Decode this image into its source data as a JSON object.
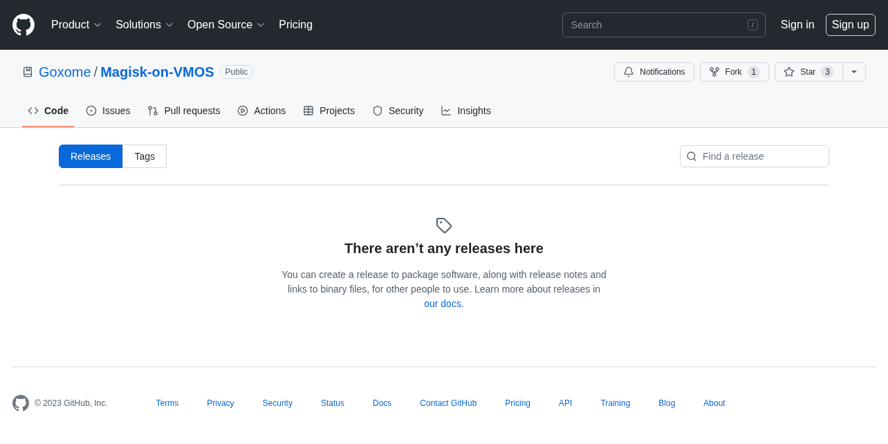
{
  "header": {
    "nav": [
      {
        "label": "Product",
        "dropdown": true
      },
      {
        "label": "Solutions",
        "dropdown": true
      },
      {
        "label": "Open Source",
        "dropdown": true
      },
      {
        "label": "Pricing",
        "dropdown": false
      }
    ],
    "search": {
      "placeholder": "Search",
      "shortcut": "/"
    },
    "sign_in": "Sign in",
    "sign_up": "Sign up"
  },
  "repo": {
    "owner": "Goxome",
    "separator": "/",
    "name": "Magisk-on-VMOS",
    "visibility": "Public",
    "actions": [
      {
        "label": "Notifications"
      },
      {
        "label": "Fork",
        "count": "1"
      },
      {
        "label": "Star",
        "count": "3"
      }
    ]
  },
  "tabs": [
    {
      "label": "Code",
      "selected": true
    },
    {
      "label": "Issues",
      "selected": false
    },
    {
      "label": "Pull requests",
      "selected": false
    },
    {
      "label": "Actions",
      "selected": false
    },
    {
      "label": "Projects",
      "selected": false
    },
    {
      "label": "Security",
      "selected": false
    },
    {
      "label": "Insights",
      "selected": false
    }
  ],
  "subnav": [
    {
      "label": "Releases",
      "selected": true
    },
    {
      "label": "Tags",
      "selected": false
    }
  ],
  "release_search": {
    "placeholder": "Find a release"
  },
  "empty": {
    "title": "There aren’t any releases here",
    "text": "You can create a release to package software, along with release notes and links to binary files, for other people to use. Learn more about releases in",
    "link": "our docs",
    "after": "."
  },
  "footer": {
    "copyright": "© 2023 GitHub, Inc.",
    "links": [
      "Terms",
      "Privacy",
      "Security",
      "Status",
      "Docs",
      "Contact GitHub",
      "Pricing",
      "API",
      "Training",
      "Blog",
      "About"
    ]
  }
}
